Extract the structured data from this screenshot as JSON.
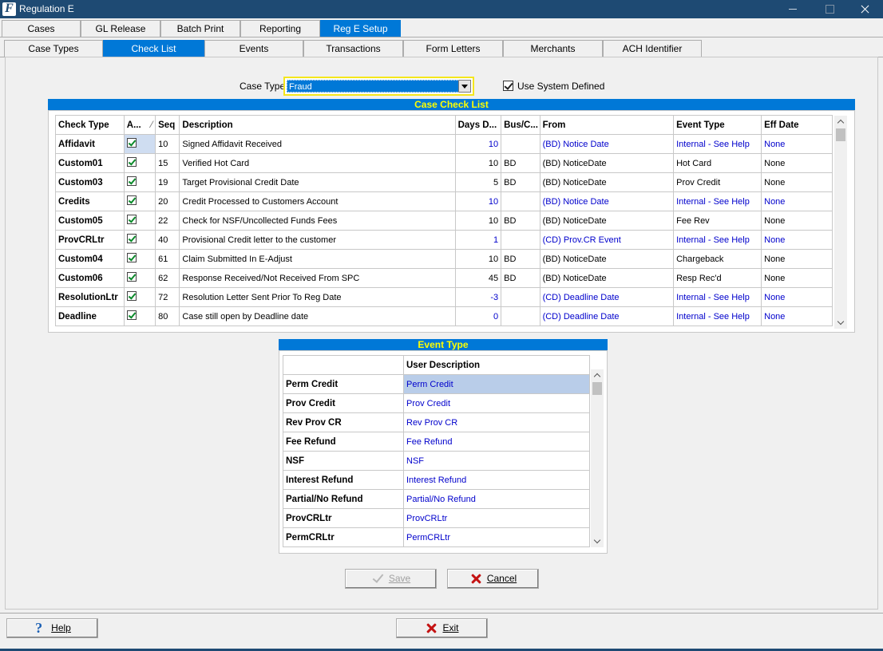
{
  "window": {
    "title": "Regulation E"
  },
  "main_tabs": [
    {
      "label": "Cases"
    },
    {
      "label": "GL Release"
    },
    {
      "label": "Batch Print"
    },
    {
      "label": "Reporting"
    },
    {
      "label": "Reg E Setup"
    }
  ],
  "sub_tabs": [
    {
      "label": "Case Types"
    },
    {
      "label": "Check List"
    },
    {
      "label": "Events"
    },
    {
      "label": "Transactions"
    },
    {
      "label": "Form Letters"
    },
    {
      "label": "Merchants"
    },
    {
      "label": "ACH Identifier"
    }
  ],
  "case_type": {
    "label": "Case Type",
    "value": "Fraud"
  },
  "use_system_defined": {
    "label": "Use System Defined",
    "checked": true
  },
  "check_list": {
    "title": "Case Check List",
    "columns": [
      "Check Type",
      "A...",
      "Seq",
      "Description",
      "Days D...",
      "Bus/C...",
      "From",
      "Event Type",
      "Eff Date"
    ],
    "rows": [
      {
        "check_type": "Affidavit",
        "seq": "10",
        "description": "Signed Affidavit Received",
        "days": "10",
        "bus": "",
        "from": "(BD) Notice Date",
        "event_type": "Internal - See Help",
        "eff_date": "None",
        "blue": true
      },
      {
        "check_type": "Custom01",
        "seq": "15",
        "description": "Verified Hot Card",
        "days": "10",
        "bus": "BD",
        "from": "(BD) NoticeDate",
        "event_type": "Hot Card",
        "eff_date": "None",
        "blue": false
      },
      {
        "check_type": "Custom03",
        "seq": "19",
        "description": "Target Provisional Credit Date",
        "days": "5",
        "bus": "BD",
        "from": "(BD) NoticeDate",
        "event_type": "Prov Credit",
        "eff_date": "None",
        "blue": false
      },
      {
        "check_type": "Credits",
        "seq": "20",
        "description": "Credit Processed to Customers Account",
        "days": "10",
        "bus": "",
        "from": "(BD) Notice Date",
        "event_type": "Internal - See Help",
        "eff_date": "None",
        "blue": true
      },
      {
        "check_type": "Custom05",
        "seq": "22",
        "description": "Check for NSF/Uncollected Funds Fees",
        "days": "10",
        "bus": "BD",
        "from": "(BD) NoticeDate",
        "event_type": "Fee Rev",
        "eff_date": "None",
        "blue": false
      },
      {
        "check_type": "ProvCRLtr",
        "seq": "40",
        "description": "Provisional Credit letter to the customer",
        "days": "1",
        "bus": "",
        "from": "(CD) Prov.CR Event",
        "event_type": "Internal - See Help",
        "eff_date": "None",
        "blue": true
      },
      {
        "check_type": "Custom04",
        "seq": "61",
        "description": "Claim Submitted In E-Adjust",
        "days": "10",
        "bus": "BD",
        "from": "(BD) NoticeDate",
        "event_type": "Chargeback",
        "eff_date": "None",
        "blue": false
      },
      {
        "check_type": "Custom06",
        "seq": "62",
        "description": "Response Received/Not Received From SPC",
        "days": "45",
        "bus": "BD",
        "from": "(BD) NoticeDate",
        "event_type": "Resp Rec'd",
        "eff_date": "None",
        "blue": false
      },
      {
        "check_type": "ResolutionLtr",
        "seq": "72",
        "description": "Resolution Letter Sent Prior To Reg Date",
        "days": "-3",
        "bus": "",
        "from": "(CD) Deadline Date",
        "event_type": "Internal - See Help",
        "eff_date": "None",
        "blue": true
      },
      {
        "check_type": "Deadline",
        "seq": "80",
        "description": "Case still open by Deadline date",
        "days": "0",
        "bus": "",
        "from": "(CD) Deadline Date",
        "event_type": "Internal - See Help",
        "eff_date": "None",
        "blue": true
      }
    ]
  },
  "event_type": {
    "title": "Event Type",
    "columns": [
      "",
      "User Description"
    ],
    "rows": [
      {
        "name": "Perm Credit",
        "desc": "Perm Credit"
      },
      {
        "name": "Prov Credit",
        "desc": "Prov Credit"
      },
      {
        "name": "Rev Prov CR",
        "desc": "Rev Prov CR"
      },
      {
        "name": "Fee Refund",
        "desc": "Fee Refund"
      },
      {
        "name": "NSF",
        "desc": "NSF"
      },
      {
        "name": "Interest Refund",
        "desc": "Interest Refund"
      },
      {
        "name": "Partial/No Refund",
        "desc": "Partial/No Refund"
      },
      {
        "name": "ProvCRLtr",
        "desc": "ProvCRLtr"
      },
      {
        "name": "PermCRLtr",
        "desc": "PermCRLtr"
      }
    ]
  },
  "buttons": {
    "save": "Save",
    "cancel": "Cancel",
    "help": "Help",
    "exit": "Exit"
  },
  "colors": {
    "title_bar": "#1e4a73",
    "accent": "#0078d7",
    "section_title_text": "#ffff00",
    "link_text": "#0000cc",
    "cancel_icon": "#c41212"
  }
}
